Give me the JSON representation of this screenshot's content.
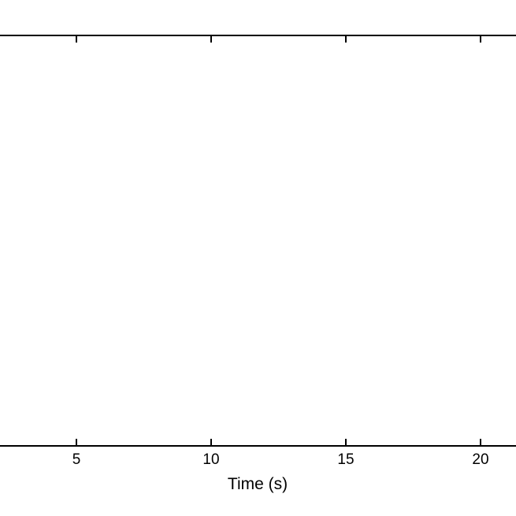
{
  "chart_data": {
    "type": "line",
    "title": "",
    "xlabel": "Time (s)",
    "ylabel": "",
    "xlim": [
      0,
      25
    ],
    "xticks": [
      5,
      10,
      15,
      20
    ],
    "xtick_labels": [
      "5",
      "10",
      "15",
      "20"
    ],
    "series": []
  }
}
